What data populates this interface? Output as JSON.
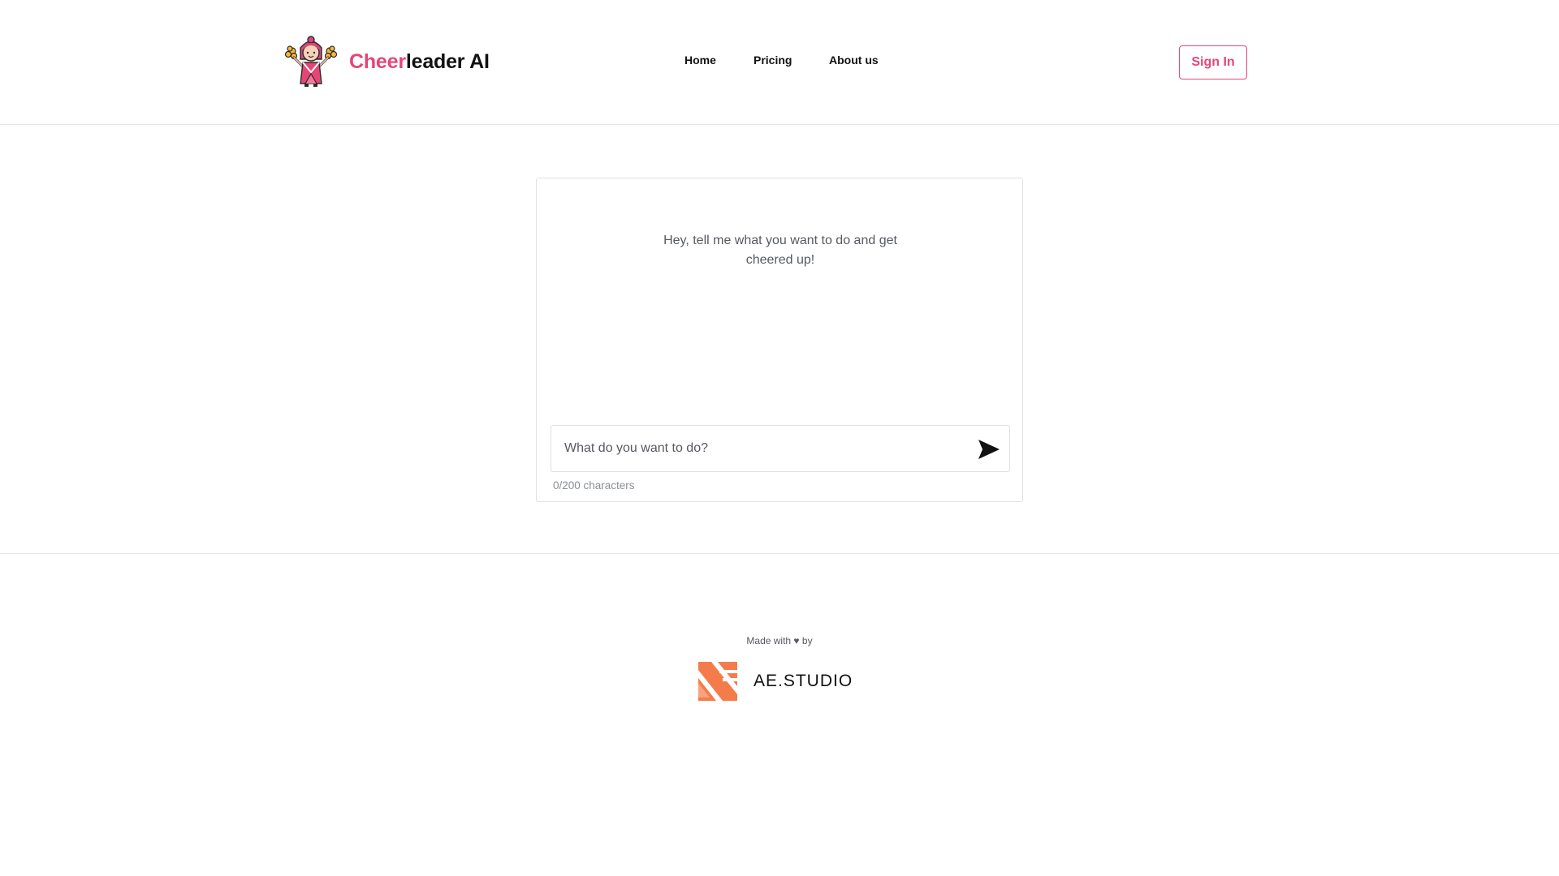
{
  "header": {
    "brand": {
      "accent": "Cheer",
      "rest": "leader AI"
    },
    "nav": [
      {
        "label": "Home"
      },
      {
        "label": "Pricing"
      },
      {
        "label": "About us"
      }
    ],
    "sign_in_label": "Sign In"
  },
  "chat": {
    "greeting": "Hey, tell me what you want to do and get cheered up!",
    "input_value": "",
    "input_placeholder": "What do you want to do?",
    "char_counter": "0/200 characters",
    "send_icon": "send-icon"
  },
  "footer": {
    "made_with": "Made with ♥ by",
    "company": "AE.STUDIO"
  },
  "colors": {
    "accent": "#e54676",
    "ae_orange": "#f47c4a",
    "border": "#e2e2e2"
  }
}
